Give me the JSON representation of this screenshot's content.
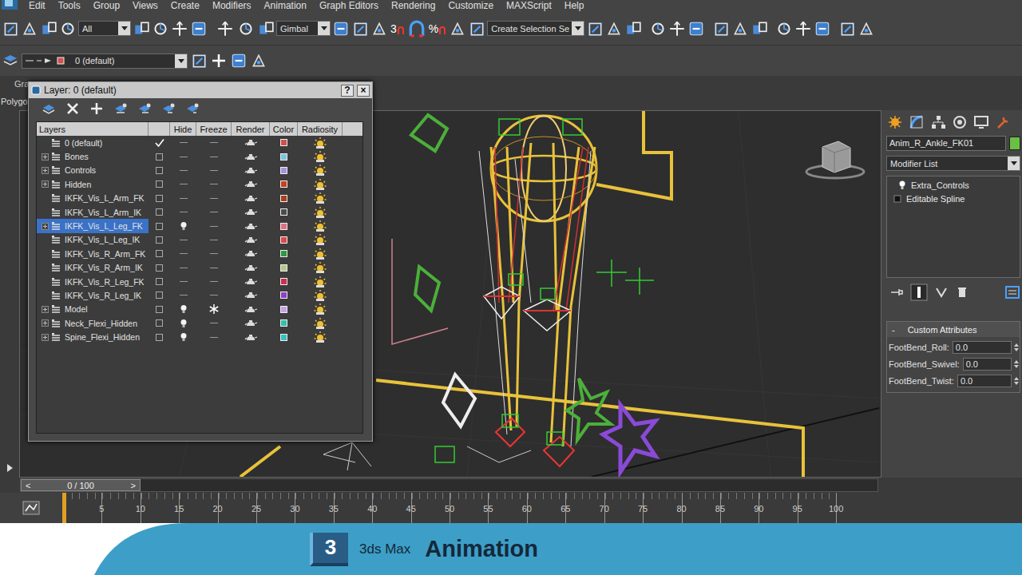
{
  "menu": [
    "Edit",
    "Tools",
    "Group",
    "Views",
    "Create",
    "Modifiers",
    "Animation",
    "Graph Editors",
    "Rendering",
    "Customize",
    "MAXScript",
    "Help"
  ],
  "toolbar": {
    "selection_filter": "All",
    "coord_system": "Gimbal",
    "snap_angle": "3",
    "snap_percent": "%",
    "named_selection": "Create Selection Se"
  },
  "layer_bar": {
    "current_layer": "0 (default)"
  },
  "ribbon": {
    "tab": "Gra",
    "panel": "Polygo"
  },
  "layer_dialog": {
    "title": "Layer: 0 (default)",
    "help": "?",
    "close": "×",
    "columns": [
      "Layers",
      "Hide",
      "Freeze",
      "Render",
      "Color",
      "Radiosity"
    ],
    "rows": [
      {
        "name": "0 (default)",
        "expandable": false,
        "current": true,
        "selected": false,
        "hidden": false,
        "frozen": false,
        "render": true,
        "radiosity": true,
        "color": "#d05050"
      },
      {
        "name": "Bones",
        "expandable": true,
        "current": false,
        "selected": false,
        "hidden": false,
        "frozen": false,
        "render": true,
        "radiosity": true,
        "color": "#7cc4e0"
      },
      {
        "name": "Controls",
        "expandable": true,
        "current": false,
        "selected": false,
        "hidden": false,
        "frozen": false,
        "render": true,
        "radiosity": true,
        "color": "#a890e0"
      },
      {
        "name": "Hidden",
        "expandable": true,
        "current": false,
        "selected": false,
        "hidden": false,
        "frozen": false,
        "render": true,
        "radiosity": true,
        "color": "#c8401c"
      },
      {
        "name": "IKFK_Vis_L_Arm_FK",
        "expandable": false,
        "current": false,
        "selected": false,
        "hidden": false,
        "frozen": false,
        "render": true,
        "radiosity": true,
        "color": "#a8401c"
      },
      {
        "name": "IKFK_Vis_L_Arm_IK",
        "expandable": false,
        "current": false,
        "selected": false,
        "hidden": false,
        "frozen": false,
        "render": true,
        "radiosity": true,
        "color": "#4c4c4c"
      },
      {
        "name": "IKFK_Vis_L_Leg_FK",
        "expandable": true,
        "current": false,
        "selected": true,
        "hidden": true,
        "frozen": false,
        "render": true,
        "radiosity": true,
        "color": "#e07080"
      },
      {
        "name": "IKFK_Vis_L_Leg_IK",
        "expandable": false,
        "current": false,
        "selected": false,
        "hidden": false,
        "frozen": false,
        "render": true,
        "radiosity": true,
        "color": "#e04848"
      },
      {
        "name": "IKFK_Vis_R_Arm_FK",
        "expandable": false,
        "current": false,
        "selected": false,
        "hidden": false,
        "frozen": false,
        "render": true,
        "radiosity": true,
        "color": "#2c9a3c"
      },
      {
        "name": "IKFK_Vis_R_Arm_IK",
        "expandable": false,
        "current": false,
        "selected": false,
        "hidden": false,
        "frozen": false,
        "render": true,
        "radiosity": true,
        "color": "#b8c488"
      },
      {
        "name": "IKFK_Vis_R_Leg_FK",
        "expandable": false,
        "current": false,
        "selected": false,
        "hidden": false,
        "frozen": false,
        "render": true,
        "radiosity": true,
        "color": "#c83050"
      },
      {
        "name": "IKFK_Vis_R_Leg_IK",
        "expandable": false,
        "current": false,
        "selected": false,
        "hidden": false,
        "frozen": false,
        "render": true,
        "radiosity": true,
        "color": "#9040c8"
      },
      {
        "name": "Model",
        "expandable": true,
        "current": false,
        "selected": false,
        "hidden": true,
        "frozen": true,
        "render": true,
        "radiosity": true,
        "color": "#c8a0e8"
      },
      {
        "name": "Neck_Flexi_Hidden",
        "expandable": true,
        "current": false,
        "selected": false,
        "hidden": true,
        "frozen": false,
        "render": true,
        "radiosity": true,
        "color": "#30c0a8"
      },
      {
        "name": "Spine_Flexi_Hidden",
        "expandable": true,
        "current": false,
        "selected": false,
        "hidden": true,
        "frozen": false,
        "render": true,
        "radiosity": true,
        "color": "#38c0c0"
      }
    ]
  },
  "command_panel": {
    "object_name": "Anim_R_Ankle_FK01",
    "object_color": "#6abf45",
    "modifier_list": "Modifier List",
    "stack": [
      {
        "name": "Extra_Controls",
        "kind": "modifier"
      },
      {
        "name": "Editable Spline",
        "kind": "base"
      }
    ],
    "rollout": {
      "collapse": "-",
      "title": "Custom Attributes",
      "params": [
        {
          "label": "FootBend_Roll:",
          "value": "0.0"
        },
        {
          "label": "FootBend_Swivel:",
          "value": "0.0"
        },
        {
          "label": "FootBend_Twist:",
          "value": "0.0"
        }
      ]
    }
  },
  "timeline": {
    "prev": "<",
    "frame": "0 / 100",
    "next": ">",
    "level": 0,
    "ticks": [
      "5",
      "10",
      "15",
      "20",
      "25",
      "30",
      "35",
      "40",
      "45",
      "50",
      "55",
      "60",
      "65",
      "70",
      "75",
      "80",
      "85",
      "90",
      "95",
      "100"
    ]
  },
  "banner": {
    "logo": "3",
    "product": "3ds Max",
    "topic": "Animation"
  }
}
